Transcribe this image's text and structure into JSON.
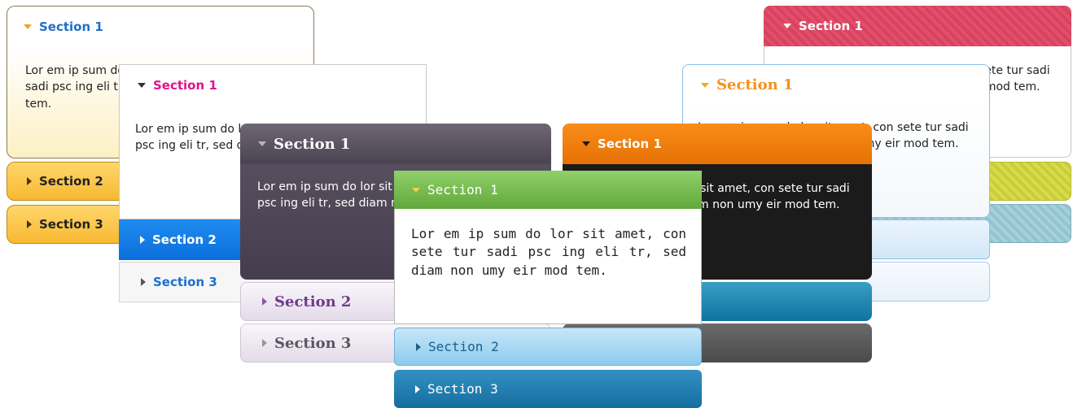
{
  "theme_yellow": {
    "section1_label": "Section 1",
    "section1_text": "Lor em ip sum do lor sit amet, con sete tur sadi psc ing eli tr, sed diam non umy eir mod tem.",
    "section2_label": "Section 2",
    "section3_label": "Section 3"
  },
  "theme_white_blue": {
    "section1_label": "Section 1",
    "section1_text": "Lor em ip sum do lor sit amet, con sete tur sadi psc ing eli tr, sed diam non umy eir mod tem.",
    "section2_label": "Section 2",
    "section3_label": "Section 3"
  },
  "theme_dark_purple": {
    "section1_label": "Section 1",
    "section1_text": "Lor em ip sum do lor sit amet, con sete tur sadi psc ing eli tr, sed diam non umy eir mod tem.",
    "section2_label": "Section 2",
    "section3_label": "Section 3"
  },
  "theme_pink_striped": {
    "section1_label": "Section 1",
    "section1_text": "Lor em ip sum do lor sit amet, con sete tur sadi psc ing eli tr, sed diam non umy eir mod tem."
  },
  "theme_light_blue": {
    "section1_label": "Section 1",
    "section1_text": "Lor em ip sum do lor sit amet, con sete tur sadi psc ing eli tr, sed diam non umy eir mod tem."
  },
  "theme_orange_black": {
    "section1_label": "Section 1",
    "section1_text": "Lor em ip sum do lor sit amet, con sete tur sadi psc ing eli tr, sed diam non umy eir mod tem."
  },
  "theme_green_sky": {
    "section1_label": "Section 1",
    "section1_text": "Lor em ip sum do lor sit amet, con sete tur sadi psc ing eli tr, sed diam non umy eir mod tem.",
    "section2_label": "Section 2",
    "section3_label": "Section 3"
  }
}
